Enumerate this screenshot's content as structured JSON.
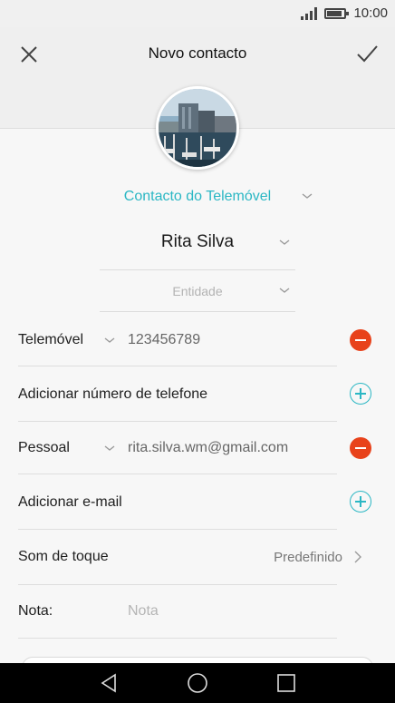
{
  "status": {
    "time": "10:00",
    "battery_level": 0.8,
    "signal_bars": 4
  },
  "header": {
    "title": "Novo contacto",
    "close_icon": "close-icon",
    "confirm_icon": "check-icon"
  },
  "account": {
    "label": "Contacto do Telemóvel"
  },
  "name": {
    "value": "Rita Silva"
  },
  "entity": {
    "placeholder": "Entidade"
  },
  "phone": {
    "type": "Telemóvel",
    "value": "123456789",
    "add_label": "Adicionar número de telefone"
  },
  "email": {
    "type": "Pessoal",
    "value": "rita.silva.wm@gmail.com",
    "add_label": "Adicionar e-mail"
  },
  "ringtone": {
    "label": "Som de toque",
    "value": "Predefinido"
  },
  "note": {
    "label": "Nota:",
    "placeholder": "Nota"
  },
  "colors": {
    "accent": "#2bb7c4",
    "remove": "#e8421b"
  },
  "nav": {
    "back_icon": "back-triangle-icon",
    "home_icon": "home-circle-icon",
    "recents_icon": "recents-square-icon"
  }
}
